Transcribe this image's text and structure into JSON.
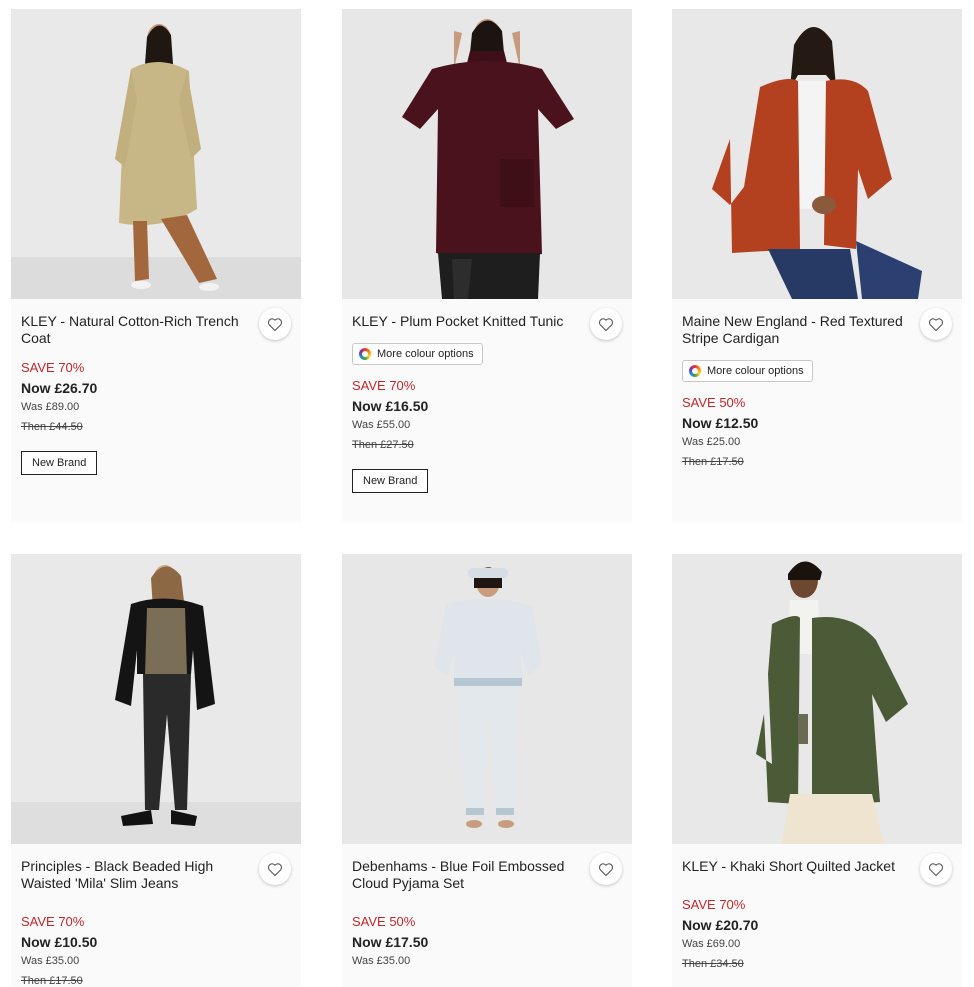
{
  "products": [
    {
      "title": "KLEY - Natural Cotton-Rich Trench Coat",
      "save": "SAVE 70%",
      "now": "Now £26.70",
      "was": "Was £89.00",
      "then": "Then £44.50",
      "badge": "New Brand"
    },
    {
      "title": "KLEY - Plum Pocket Knitted Tunic",
      "colour_options": "More colour options",
      "save": "SAVE 70%",
      "now": "Now £16.50",
      "was": "Was £55.00",
      "then": "Then £27.50",
      "badge": "New Brand"
    },
    {
      "title": "Maine New England - Red Textured Stripe Cardigan",
      "colour_options": "More colour options",
      "save": "SAVE 50%",
      "now": "Now £12.50",
      "was": "Was £25.00",
      "then": "Then £17.50"
    },
    {
      "title": "Principles - Black Beaded High Waisted 'Mila' Slim Jeans",
      "save": "SAVE 70%",
      "now": "Now £10.50",
      "was": "Was £35.00",
      "then": "Then £17.50"
    },
    {
      "title": "Debenhams - Blue Foil Embossed Cloud Pyjama Set",
      "save": "SAVE 50%",
      "now": "Now £17.50",
      "was": "Was £35.00"
    },
    {
      "title": "KLEY - Khaki Short Quilted Jacket",
      "save": "SAVE 70%",
      "now": "Now £20.70",
      "was": "Was £69.00",
      "then": "Then £34.50"
    }
  ],
  "icons": {
    "wishlist": "heart-outline-icon",
    "colour": "colour-wheel-icon"
  },
  "colors": {
    "sale_red": "#c0282d",
    "card_bg": "#fafafa"
  }
}
